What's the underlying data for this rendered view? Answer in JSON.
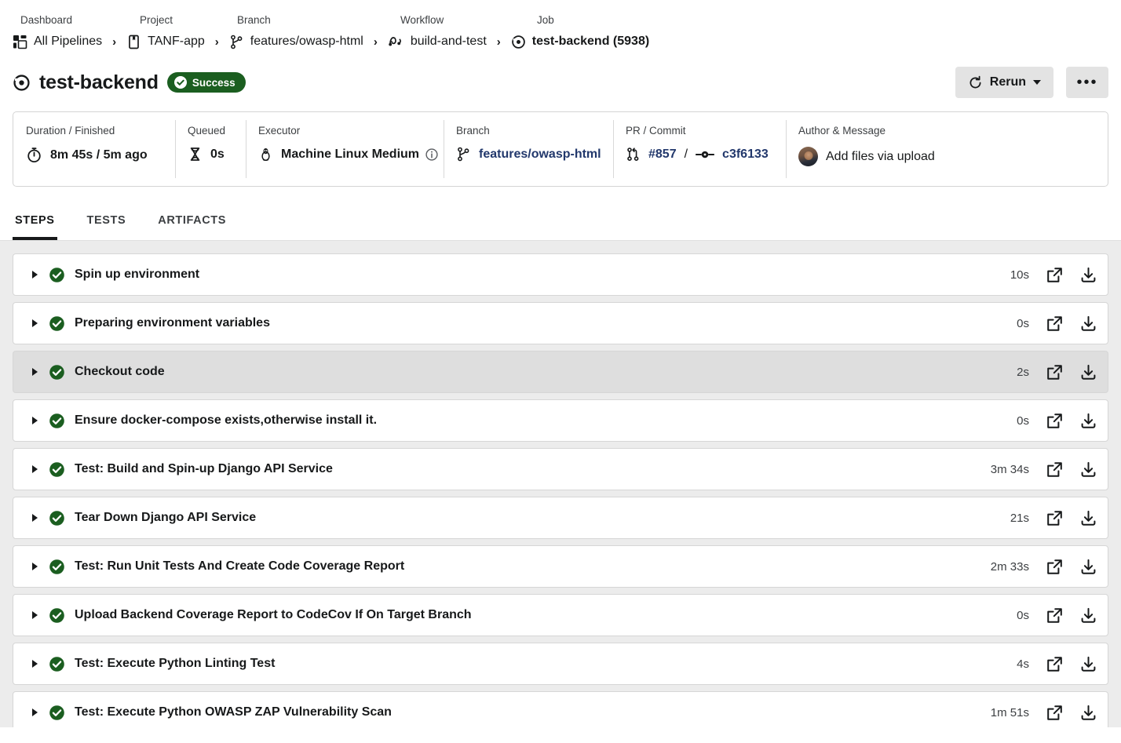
{
  "breadcrumb": {
    "labels": [
      "Dashboard",
      "Project",
      "Branch",
      "Workflow",
      "Job"
    ],
    "items": [
      {
        "text": "All Pipelines",
        "icon": "dashboard-grid-icon"
      },
      {
        "text": "TANF-app",
        "icon": "project-card-icon"
      },
      {
        "text": "features/owasp-html",
        "icon": "branch-icon"
      },
      {
        "text": "build-and-test",
        "icon": "workflow-icon"
      },
      {
        "text": "test-backend (5938)",
        "icon": "job-icon"
      }
    ],
    "separator": "›"
  },
  "header": {
    "title": "test-backend",
    "status_badge": "Success",
    "status_color": "#1b5e20",
    "rerun_label": "Rerun",
    "overflow_label": "•••"
  },
  "info": {
    "duration": {
      "label": "Duration / Finished",
      "value": "8m 45s / 5m ago",
      "icon": "stopwatch-icon"
    },
    "queued": {
      "label": "Queued",
      "value": "0s",
      "icon": "hourglass-icon"
    },
    "executor": {
      "label": "Executor",
      "value": "Machine Linux Medium",
      "icon": "linux-penguin-icon",
      "info_icon": "info-circle-icon"
    },
    "branch": {
      "label": "Branch",
      "value": "features/owasp-html",
      "icon": "branch-icon",
      "link_color": "#22386c"
    },
    "commit": {
      "label": "PR / Commit",
      "pr": "#857",
      "separator": "/",
      "sha": "c3f6133",
      "pr_icon": "pull-request-icon",
      "commit_icon": "commit-icon"
    },
    "author": {
      "label": "Author & Message",
      "message": "Add files via upload",
      "avatar": "user-avatar"
    }
  },
  "tabs": [
    {
      "label": "STEPS",
      "active": true
    },
    {
      "label": "TESTS",
      "active": false
    },
    {
      "label": "ARTIFACTS",
      "active": false
    }
  ],
  "steps": [
    {
      "name": "Spin up environment",
      "duration": "10s",
      "status": "success",
      "highlighted": false
    },
    {
      "name": "Preparing environment variables",
      "duration": "0s",
      "status": "success",
      "highlighted": false
    },
    {
      "name": "Checkout code",
      "duration": "2s",
      "status": "success",
      "highlighted": true
    },
    {
      "name": "Ensure docker-compose exists,otherwise install it.",
      "duration": "0s",
      "status": "success",
      "highlighted": false
    },
    {
      "name": "Test: Build and Spin-up Django API Service",
      "duration": "3m 34s",
      "status": "success",
      "highlighted": false
    },
    {
      "name": "Tear Down Django API Service",
      "duration": "21s",
      "status": "success",
      "highlighted": false
    },
    {
      "name": "Test: Run Unit Tests And Create Code Coverage Report",
      "duration": "2m 33s",
      "status": "success",
      "highlighted": false
    },
    {
      "name": "Upload Backend Coverage Report to CodeCov If On Target Branch",
      "duration": "0s",
      "status": "success",
      "highlighted": false
    },
    {
      "name": "Test: Execute Python Linting Test",
      "duration": "4s",
      "status": "success",
      "highlighted": false
    },
    {
      "name": "Test: Execute Python OWASP ZAP Vulnerability Scan",
      "duration": "1m 51s",
      "status": "success",
      "highlighted": false
    }
  ],
  "step_actions": {
    "open_icon": "external-link-icon",
    "download_icon": "download-icon"
  }
}
